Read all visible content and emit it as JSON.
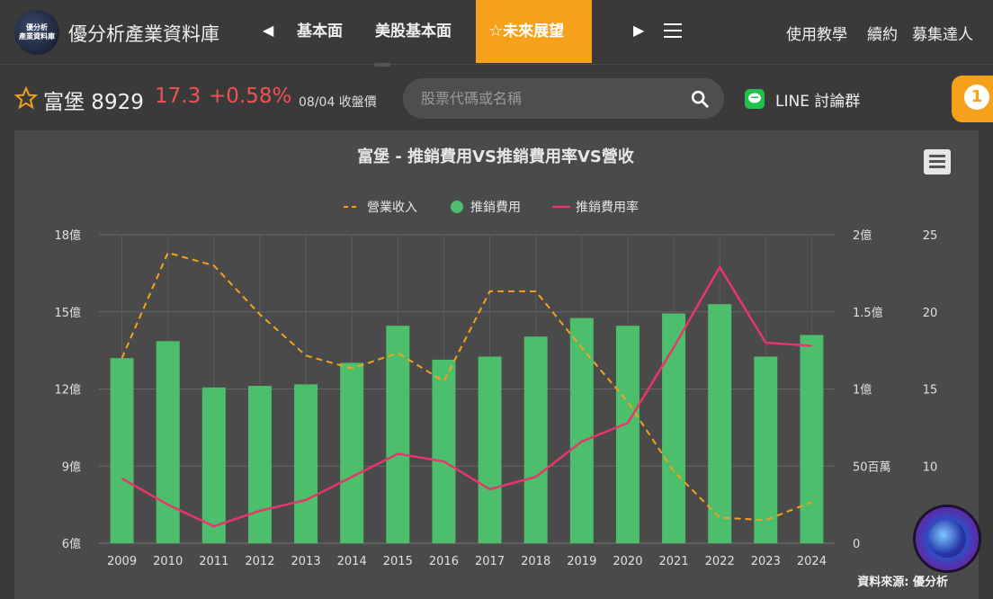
{
  "header": {
    "logo_line1": "優分析",
    "logo_line2": "產業資料庫",
    "brand": "優分析產業資料庫",
    "nav": [
      "基本面",
      "美股基本面",
      "未來展望"
    ],
    "links": [
      "使用教學",
      "續約",
      "募集達人"
    ]
  },
  "quote": {
    "name": "富堡 8929",
    "price": "17.3",
    "change": "+0.58%",
    "date": "08/04 收盤價",
    "search_placeholder": "股票代碼或名稱",
    "line_label": "LINE 討論群",
    "badge": "1"
  },
  "colors": {
    "accent": "#f5a21a",
    "bar": "#4cbe6c",
    "revenue": "#f5a21a",
    "ratio": "#e8356b",
    "up": "#ef5350"
  },
  "chart_data": {
    "type": "bar",
    "title": "富堡 - 推銷費用VS推銷費用率VS營收",
    "source": "資料來源: 優分析",
    "categories": [
      "2009",
      "2010",
      "2011",
      "2012",
      "2013",
      "2014",
      "2015",
      "2016",
      "2017",
      "2018",
      "2019",
      "2020",
      "2021",
      "2022",
      "2023",
      "2024"
    ],
    "left_axis": {
      "ticks": [
        "6億",
        "9億",
        "12億",
        "15億",
        "18億"
      ],
      "ylim": [
        6,
        18
      ]
    },
    "right_axis1": {
      "ticks": [
        "0",
        "50百萬",
        "1億",
        "1.5億",
        "2億"
      ],
      "ylim": [
        0,
        200
      ]
    },
    "right_axis2": {
      "ticks": [
        "10",
        "15",
        "20",
        "25"
      ],
      "ylim": [
        5,
        25
      ]
    },
    "legend": [
      "營業收入",
      "推銷費用",
      "推銷費用率"
    ],
    "series": [
      {
        "name": "營業收入",
        "axis": "left",
        "style": "dashed-line",
        "values": [
          13.2,
          17.3,
          16.8,
          14.9,
          13.3,
          12.8,
          13.4,
          12.3,
          15.8,
          15.8,
          13.6,
          11.5,
          8.8,
          7.0,
          6.9,
          7.6
        ]
      },
      {
        "name": "推銷費用",
        "axis": "right1",
        "style": "bar",
        "values": [
          120,
          131,
          101,
          102,
          103,
          117,
          141,
          119,
          121,
          134,
          146,
          141,
          149,
          155,
          121,
          135
        ]
      },
      {
        "name": "推銷費用率",
        "axis": "right2",
        "style": "line",
        "values": [
          9.2,
          7.5,
          6.1,
          7.1,
          7.8,
          9.3,
          10.8,
          10.3,
          8.5,
          9.3,
          11.6,
          12.8,
          17.7,
          22.9,
          18.0,
          17.8
        ]
      }
    ]
  }
}
